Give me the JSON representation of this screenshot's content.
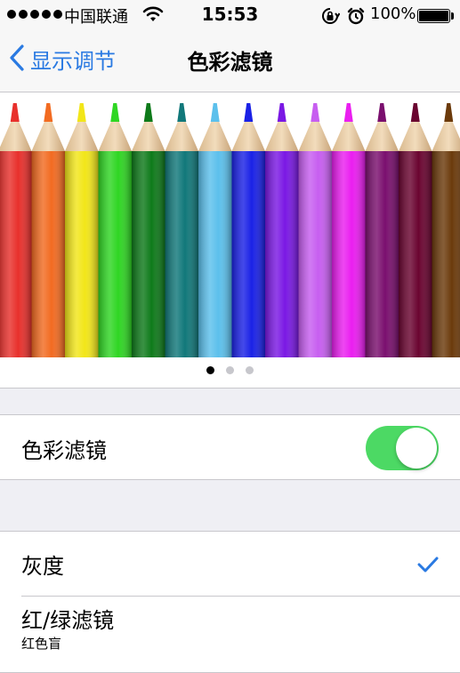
{
  "status_bar": {
    "carrier": "中国联通",
    "time": "15:53",
    "battery": "100%"
  },
  "nav": {
    "back_label": "显示调节",
    "title": "色彩滤镜"
  },
  "preview": {
    "pencil_colors": [
      "#e8302c",
      "#f26b21",
      "#f2e619",
      "#2fd623",
      "#0e7a1a",
      "#11787a",
      "#5cc0ec",
      "#1a21e6",
      "#7a18e4",
      "#c75ef0",
      "#ea1ef0",
      "#7a0f6e",
      "#6a0430",
      "#6b3a0b"
    ],
    "page_count": 3,
    "current_page": 1
  },
  "filter_toggle": {
    "label": "色彩滤镜",
    "on": true
  },
  "filters": [
    {
      "label": "灰度",
      "selected": true
    },
    {
      "label": "红/绿滤镜",
      "sublabel": "红色盲",
      "selected": false
    }
  ],
  "accent_color": "#2a7ae2",
  "toggle_color": "#4cd964"
}
